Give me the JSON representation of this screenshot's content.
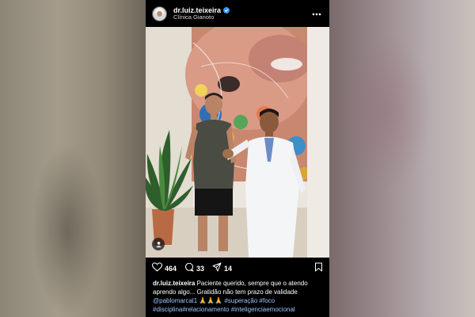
{
  "post": {
    "username": "dr.luiz.teixeira",
    "location": "Clínica Gianoto",
    "likes": "464",
    "comments": "33",
    "shares": "14",
    "caption": {
      "user": "dr.luiz.teixeira",
      "text": " Paciente querido, sempre que o atendo aprendo algo... Gratidão não tem prazo de validade ",
      "mention": "@pablomarcal1",
      "emoji": " 🙏🙏🙏 ",
      "tags": [
        "#superação",
        "#foco",
        "#disciplina",
        "#relacionamento",
        "#inteligenciaemocional"
      ]
    }
  },
  "colors": {
    "background": "#000000",
    "verified": "#3897f0",
    "hashtag": "#9cc3ff"
  },
  "icons": [
    "more-icon",
    "verified-icon",
    "heart-icon",
    "comment-icon",
    "share-icon",
    "bookmark-icon",
    "user-tag-icon"
  ]
}
